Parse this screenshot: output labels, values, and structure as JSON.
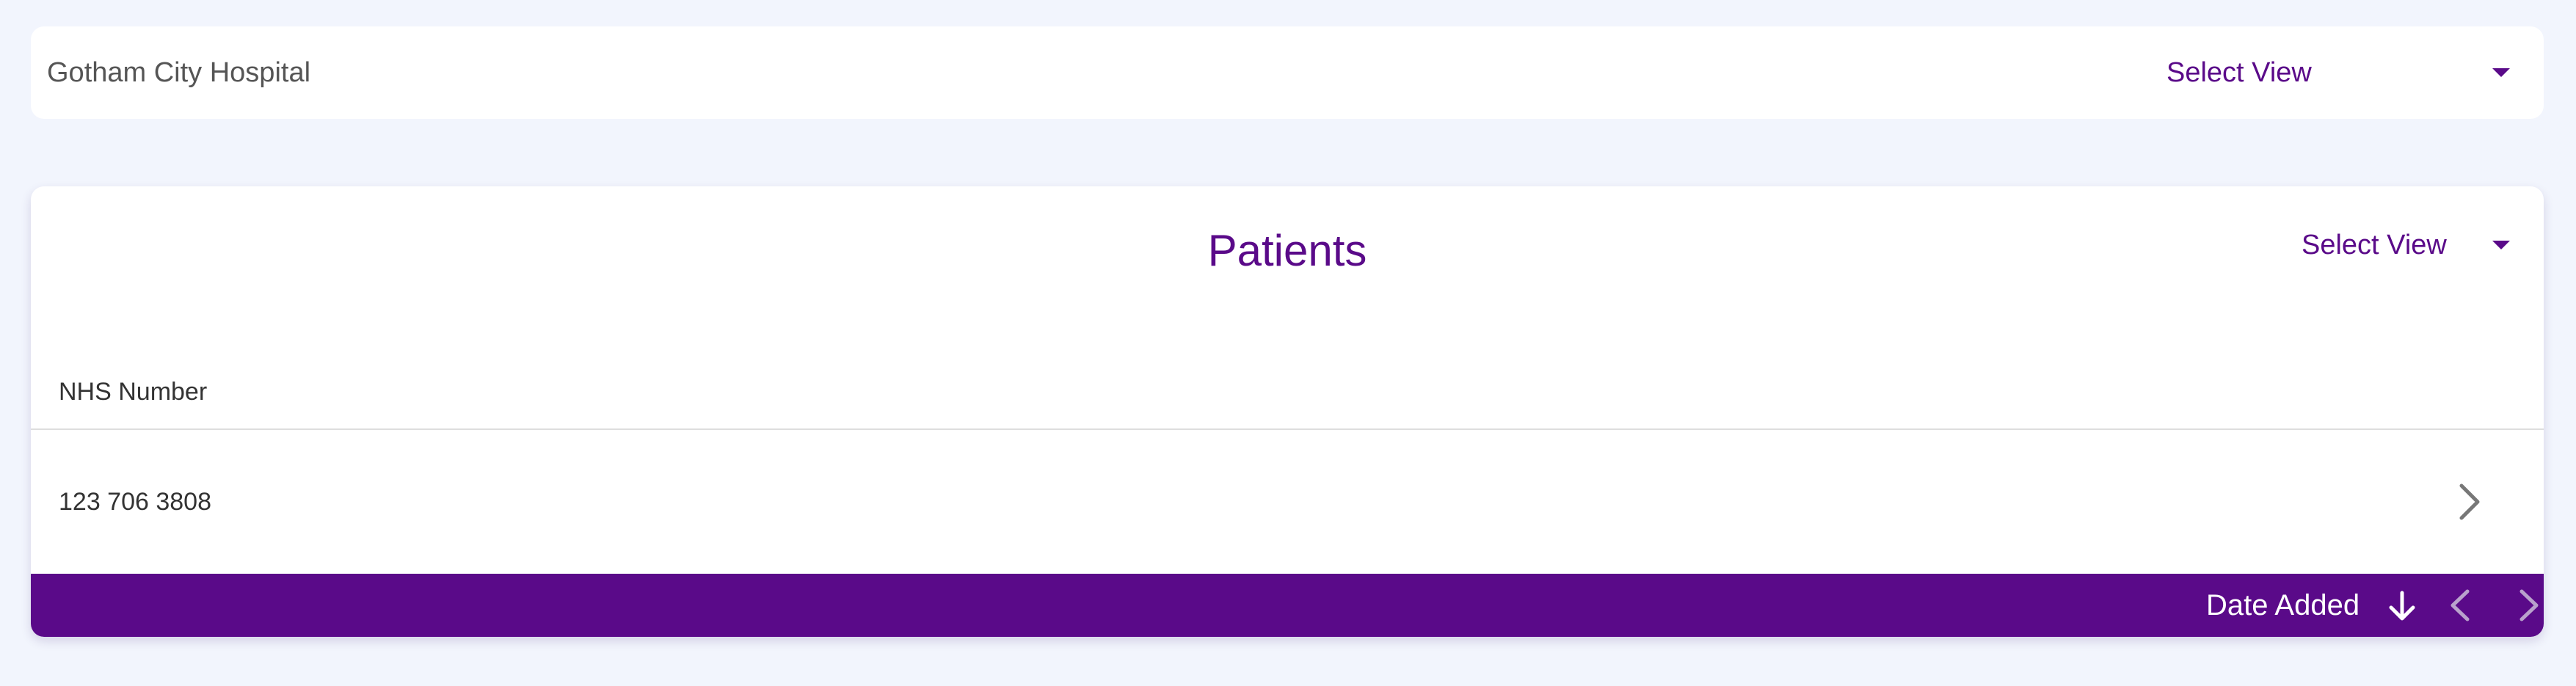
{
  "header": {
    "organization": "Gotham City Hospital",
    "select_view_label": "Select View"
  },
  "patients_card": {
    "title": "Patients",
    "select_view_label": "Select View",
    "columns": [
      "NHS Number"
    ],
    "rows": [
      {
        "nhs_number": "123 706 3808"
      }
    ],
    "footer": {
      "sort_label": "Date Added",
      "sort_direction_icon": "arrow-down-icon",
      "prev_page_icon": "chevron-left-icon",
      "next_page_icon": "chevron-right-icon"
    }
  },
  "colors": {
    "page_background": "#f2f5fd",
    "card_background": "#ffffff",
    "accent_purple": "#5a0a89",
    "text_dark": "#333333",
    "text_muted": "#555555",
    "chevron_gray": "#777777",
    "disabled_chevron": "#b9a2cc"
  }
}
